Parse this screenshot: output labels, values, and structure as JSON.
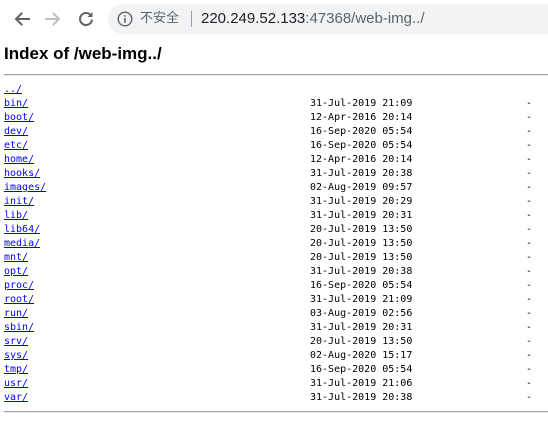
{
  "browser": {
    "security_label": "不安全",
    "url_host": "220.249.52.133",
    "url_rest": ":47368/web-img../"
  },
  "page": {
    "title": "Index of /web-img../"
  },
  "listing": {
    "parent": "../",
    "entries": [
      {
        "name": "bin/",
        "date": "31-Jul-2019 21:09",
        "size": "-"
      },
      {
        "name": "boot/",
        "date": "12-Apr-2016 20:14",
        "size": "-"
      },
      {
        "name": "dev/",
        "date": "16-Sep-2020 05:54",
        "size": "-"
      },
      {
        "name": "etc/",
        "date": "16-Sep-2020 05:54",
        "size": "-"
      },
      {
        "name": "home/",
        "date": "12-Apr-2016 20:14",
        "size": "-"
      },
      {
        "name": "hooks/",
        "date": "31-Jul-2019 20:38",
        "size": "-"
      },
      {
        "name": "images/",
        "date": "02-Aug-2019 09:57",
        "size": "-"
      },
      {
        "name": "init/",
        "date": "31-Jul-2019 20:29",
        "size": "-"
      },
      {
        "name": "lib/",
        "date": "31-Jul-2019 20:31",
        "size": "-"
      },
      {
        "name": "lib64/",
        "date": "20-Jul-2019 13:50",
        "size": "-"
      },
      {
        "name": "media/",
        "date": "20-Jul-2019 13:50",
        "size": "-"
      },
      {
        "name": "mnt/",
        "date": "20-Jul-2019 13:50",
        "size": "-"
      },
      {
        "name": "opt/",
        "date": "31-Jul-2019 20:38",
        "size": "-"
      },
      {
        "name": "proc/",
        "date": "16-Sep-2020 05:54",
        "size": "-"
      },
      {
        "name": "root/",
        "date": "31-Jul-2019 21:09",
        "size": "-"
      },
      {
        "name": "run/",
        "date": "03-Aug-2019 02:56",
        "size": "-"
      },
      {
        "name": "sbin/",
        "date": "31-Jul-2019 20:31",
        "size": "-"
      },
      {
        "name": "srv/",
        "date": "20-Jul-2019 13:50",
        "size": "-"
      },
      {
        "name": "sys/",
        "date": "02-Aug-2020 15:17",
        "size": "-"
      },
      {
        "name": "tmp/",
        "date": "16-Sep-2020 05:54",
        "size": "-"
      },
      {
        "name": "usr/",
        "date": "31-Jul-2019 21:06",
        "size": "-"
      },
      {
        "name": "var/",
        "date": "31-Jul-2019 20:38",
        "size": "-"
      }
    ]
  }
}
